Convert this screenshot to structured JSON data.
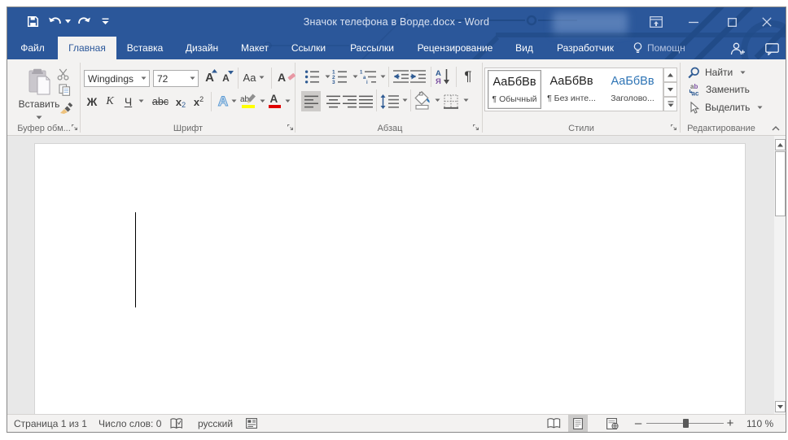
{
  "window": {
    "title": "Значок телефона в Ворде.docx - Word",
    "controls": [
      {
        "icon": "ribbon-display-options"
      },
      {
        "icon": "minimize"
      },
      {
        "icon": "maximize"
      },
      {
        "icon": "close"
      }
    ]
  },
  "quick_access": {
    "icons": [
      "save",
      "undo",
      "redo",
      "customize-quick-access-toolbar"
    ]
  },
  "tabs": [
    {
      "label": "Файл",
      "selected": false
    },
    {
      "label": "Главная",
      "selected": true
    },
    {
      "label": "Вставка",
      "selected": false
    },
    {
      "label": "Дизайн",
      "selected": false
    },
    {
      "label": "Макет",
      "selected": false
    },
    {
      "label": "Ссылки",
      "selected": false
    },
    {
      "label": "Рассылки",
      "selected": false
    },
    {
      "label": "Рецензирование",
      "selected": false
    },
    {
      "label": "Вид",
      "selected": false
    },
    {
      "label": "Разработчик",
      "selected": false
    }
  ],
  "tell_me": {
    "label": "Помощн",
    "icon": "lightbulb"
  },
  "account": {
    "icon": "sign-in-person"
  },
  "share": {
    "icon": "comment-bubble"
  },
  "ribbon": {
    "clipboard": {
      "paste_label": "Вставить",
      "group_label": "Буфер обм...",
      "icons": [
        "cut-scissors",
        "copy",
        "format-painter"
      ]
    },
    "font": {
      "font_name": "Wingdings",
      "font_size": "72",
      "grow_font": "А",
      "shrink_font": "A",
      "change_case": "Aa",
      "clear_formatting": "A",
      "bold": "Ж",
      "italic": "К",
      "underline": "Ч",
      "strikethrough": "abc",
      "subscript_base": "x",
      "subscript_mark": "2",
      "superscript_base": "x",
      "superscript_mark": "2",
      "text_effects": "А",
      "highlight": "ab",
      "font_color": "А",
      "group_label": "Шрифт"
    },
    "paragraph": {
      "group_label": "Абзац",
      "numbering_digits": [
        "1",
        "2",
        "3"
      ],
      "multilevel_marks": [
        "1",
        "a",
        "i"
      ],
      "sort_top": "А",
      "sort_bottom": "Я",
      "pilcrow": "¶"
    },
    "styles": {
      "group_label": "Стили",
      "items": [
        {
          "preview": "АаБбВв",
          "name": "¶ Обычный",
          "selected": true
        },
        {
          "preview": "АаБбВв",
          "name": "¶ Без инте...",
          "selected": false
        },
        {
          "preview": "АаБбВв",
          "name": "Заголово...",
          "selected": false
        }
      ]
    },
    "editing": {
      "find_label": "Найти",
      "replace_label": "Заменить",
      "select_label": "Выделить",
      "group_label": "Редактирование"
    }
  },
  "statusbar": {
    "page_info": "Страница 1 из 1",
    "word_count": "Число слов: 0",
    "language": "русский",
    "zoom_out": "–",
    "zoom_in": "+",
    "zoom_level": "110 %"
  },
  "colors": {
    "titlebar_blue": "#2b579a",
    "ribbon_bg": "#f3f2f1",
    "doc_bg": "#e8e8e8",
    "heading_style_blue": "#2e74b5",
    "highlight_yellow": "#ffff00",
    "font_color_red": "#e00000"
  }
}
